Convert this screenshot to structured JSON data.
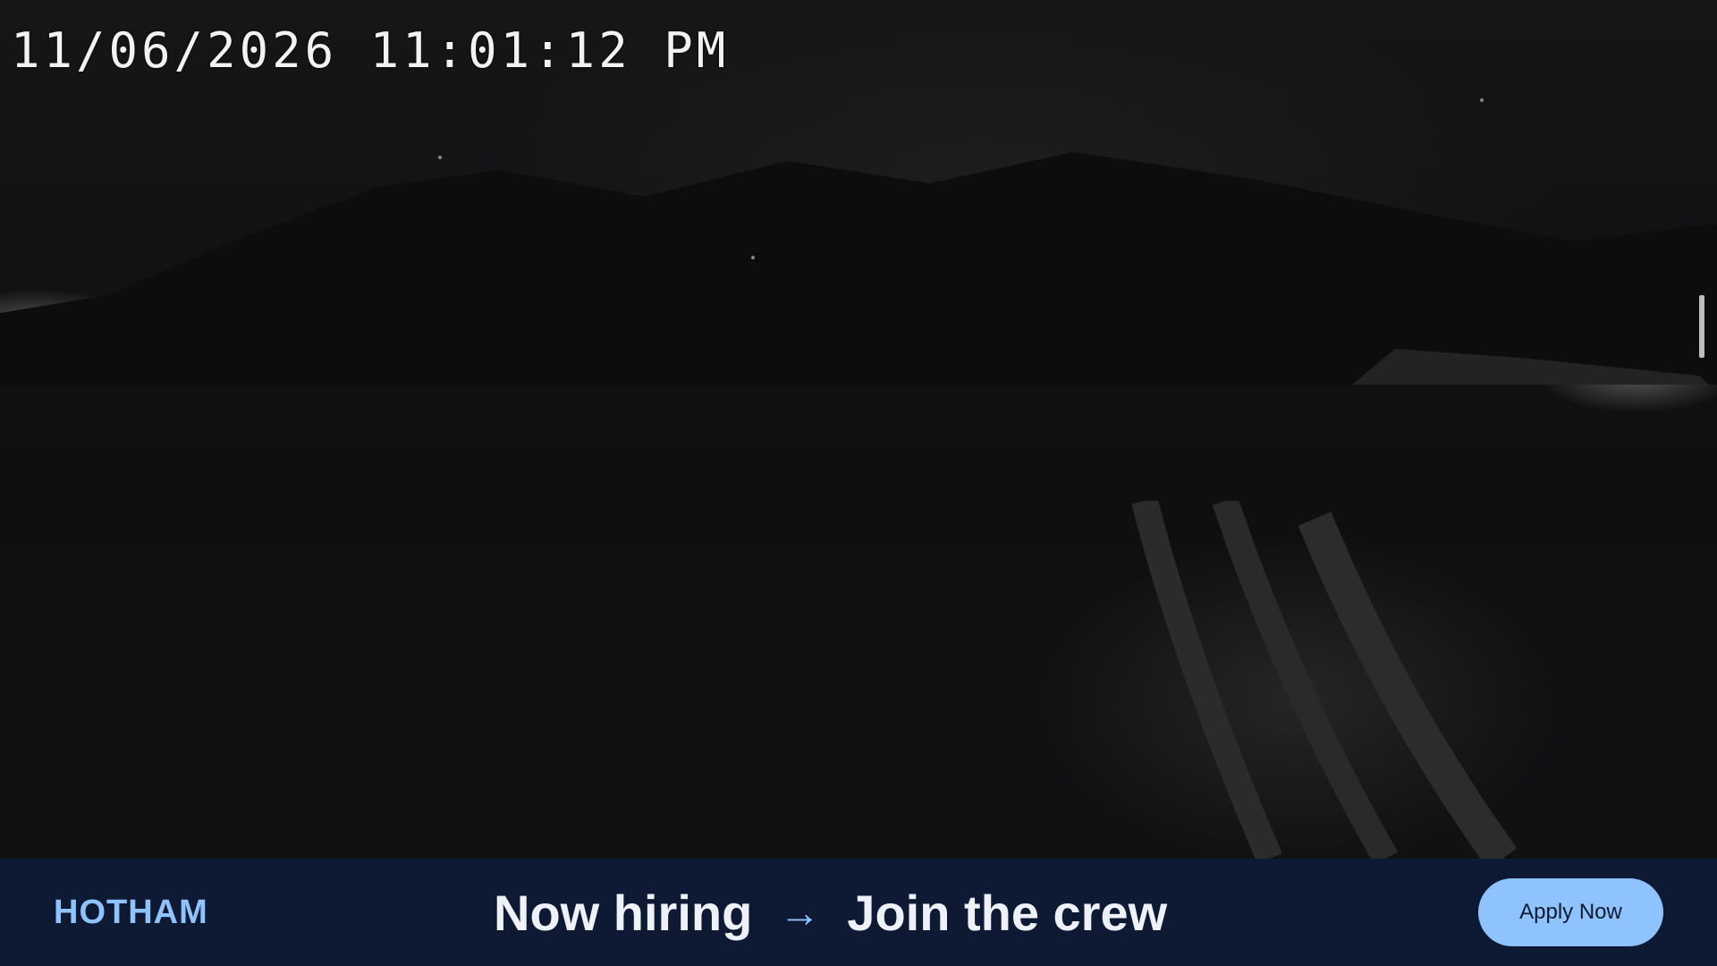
{
  "camera": {
    "timestamp": "11/06/2026 11:01:12 PM"
  },
  "banner": {
    "logo_text": "HOTHAM",
    "headline_left": "Now hiring",
    "arrow_icon": "arrow-right-icon",
    "headline_right": "Join the crew",
    "apply_label": "Apply Now",
    "colors": {
      "background": "#0e1a33",
      "accent": "#8fc3ff",
      "headline": "#eef2f8"
    }
  }
}
